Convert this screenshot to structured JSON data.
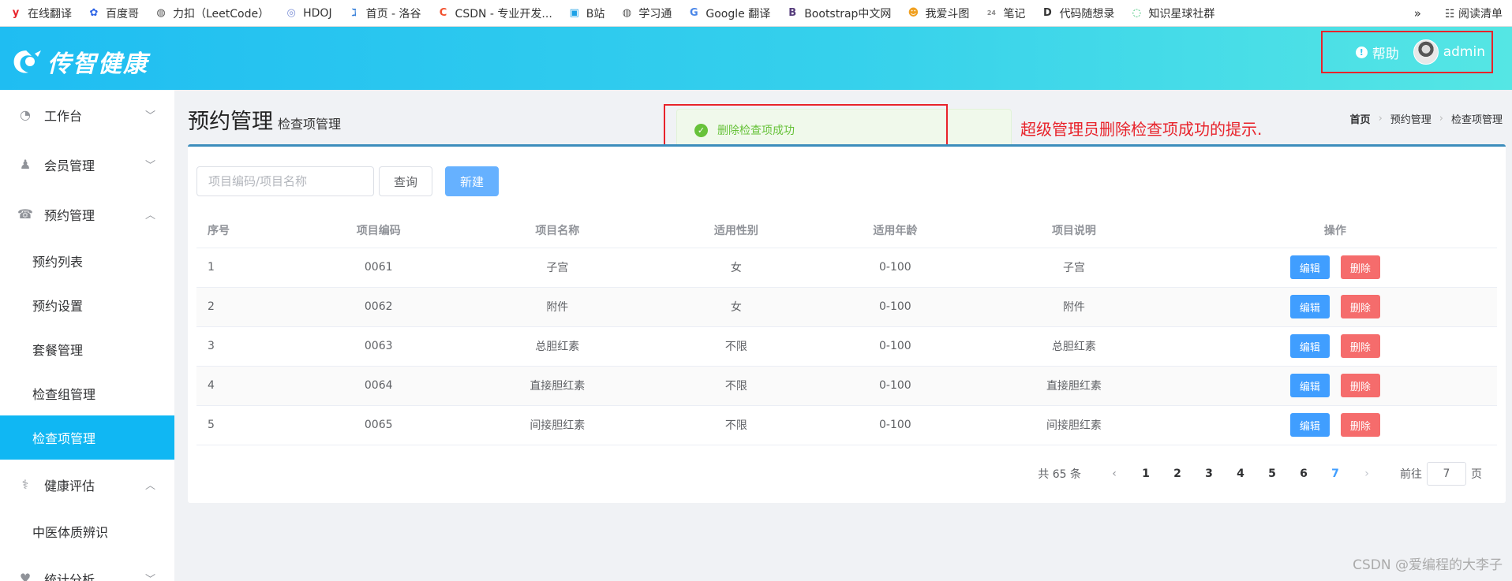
{
  "bookmarks": [
    {
      "label": "在线翻译",
      "icon": "youdao-icon",
      "glyph": "y",
      "color": "#e8232b"
    },
    {
      "label": "百度哥",
      "icon": "baidu-icon",
      "glyph": "✿",
      "color": "#2a62e6"
    },
    {
      "label": "力扣（LeetCode）",
      "icon": "globe-icon",
      "glyph": "◍",
      "color": "#555"
    },
    {
      "label": "HDOJ",
      "icon": "hdoj-icon",
      "glyph": "◎",
      "color": "#7b8fd6"
    },
    {
      "label": "首页 - 洛谷",
      "icon": "luogu-icon",
      "glyph": "ℷ",
      "color": "#2f7bd8"
    },
    {
      "label": "CSDN - 专业开发...",
      "icon": "csdn-icon",
      "glyph": "C",
      "color": "#f2512f"
    },
    {
      "label": "B站",
      "icon": "bilibili-icon",
      "glyph": "▣",
      "color": "#1da1e6"
    },
    {
      "label": "学习通",
      "icon": "globe-icon",
      "glyph": "◍",
      "color": "#555"
    },
    {
      "label": "Google 翻译",
      "icon": "google-translate-icon",
      "glyph": "G",
      "color": "#4a86e8"
    },
    {
      "label": "Bootstrap中文网",
      "icon": "bootstrap-icon",
      "glyph": "B",
      "color": "#563d7c"
    },
    {
      "label": "我爱斗图",
      "icon": "doutu-icon",
      "glyph": "☻",
      "color": "#f0a020"
    },
    {
      "label": "笔记",
      "icon": "calendar-icon",
      "glyph": "24",
      "color": "#888"
    },
    {
      "label": "代码随想录",
      "icon": "code-icon",
      "glyph": "D",
      "color": "#333"
    },
    {
      "label": "知识星球社群",
      "icon": "planet-icon",
      "glyph": "◌",
      "color": "#2bbf6a"
    }
  ],
  "bookmarks_more": "»",
  "reading_list": "阅读清单",
  "header": {
    "logo_text": "传智健康",
    "help_label": "帮助",
    "user_name": "admin"
  },
  "sidebar": {
    "groups": [
      {
        "label": "工作台",
        "icon": "dashboard-icon",
        "expanded": false,
        "items": []
      },
      {
        "label": "会员管理",
        "icon": "user-icon",
        "expanded": false,
        "items": []
      },
      {
        "label": "预约管理",
        "icon": "phone-icon",
        "expanded": true,
        "items": [
          "预约列表",
          "预约设置",
          "套餐管理",
          "检查组管理",
          "检查项管理"
        ]
      },
      {
        "label": "健康评估",
        "icon": "stethoscope-icon",
        "expanded": true,
        "items": [
          "中医体质辨识"
        ]
      },
      {
        "label": "统计分析",
        "icon": "heart-icon",
        "expanded": false,
        "items": []
      }
    ],
    "active_item": "检查项管理"
  },
  "main": {
    "title": "预约管理",
    "subtitle": "检查项管理",
    "breadcrumb": [
      "首页",
      "预约管理",
      "检查项管理"
    ],
    "annotation": "超级管理员删除检查项成功的提示.",
    "toast": "删除检查项成功"
  },
  "toolbar": {
    "search_placeholder": "项目编码/项目名称",
    "search_value": "",
    "query_label": "查询",
    "new_label": "新建"
  },
  "table": {
    "columns": [
      "序号",
      "项目编码",
      "项目名称",
      "适用性别",
      "适用年龄",
      "项目说明",
      "操作"
    ],
    "rows": [
      {
        "idx": "1",
        "code": "0061",
        "name": "子宫",
        "sex": "女",
        "age": "0-100",
        "remark": "子宫"
      },
      {
        "idx": "2",
        "code": "0062",
        "name": "附件",
        "sex": "女",
        "age": "0-100",
        "remark": "附件"
      },
      {
        "idx": "3",
        "code": "0063",
        "name": "总胆红素",
        "sex": "不限",
        "age": "0-100",
        "remark": "总胆红素"
      },
      {
        "idx": "4",
        "code": "0064",
        "name": "直接胆红素",
        "sex": "不限",
        "age": "0-100",
        "remark": "直接胆红素"
      },
      {
        "idx": "5",
        "code": "0065",
        "name": "间接胆红素",
        "sex": "不限",
        "age": "0-100",
        "remark": "间接胆红素"
      }
    ],
    "edit_label": "编辑",
    "delete_label": "删除"
  },
  "pagination": {
    "total_text": "共 65 条",
    "pages": [
      "1",
      "2",
      "3",
      "4",
      "5",
      "6",
      "7"
    ],
    "current": "7",
    "goto_prefix": "前往",
    "goto_value": "7",
    "goto_suffix": "页"
  },
  "watermark": "CSDN @爱编程的大李子",
  "colors": {
    "accent": "#10b7f3",
    "primary": "#409eff",
    "danger": "#f56c6c",
    "success": "#67c23a",
    "highlight_red": "#e8232b"
  }
}
